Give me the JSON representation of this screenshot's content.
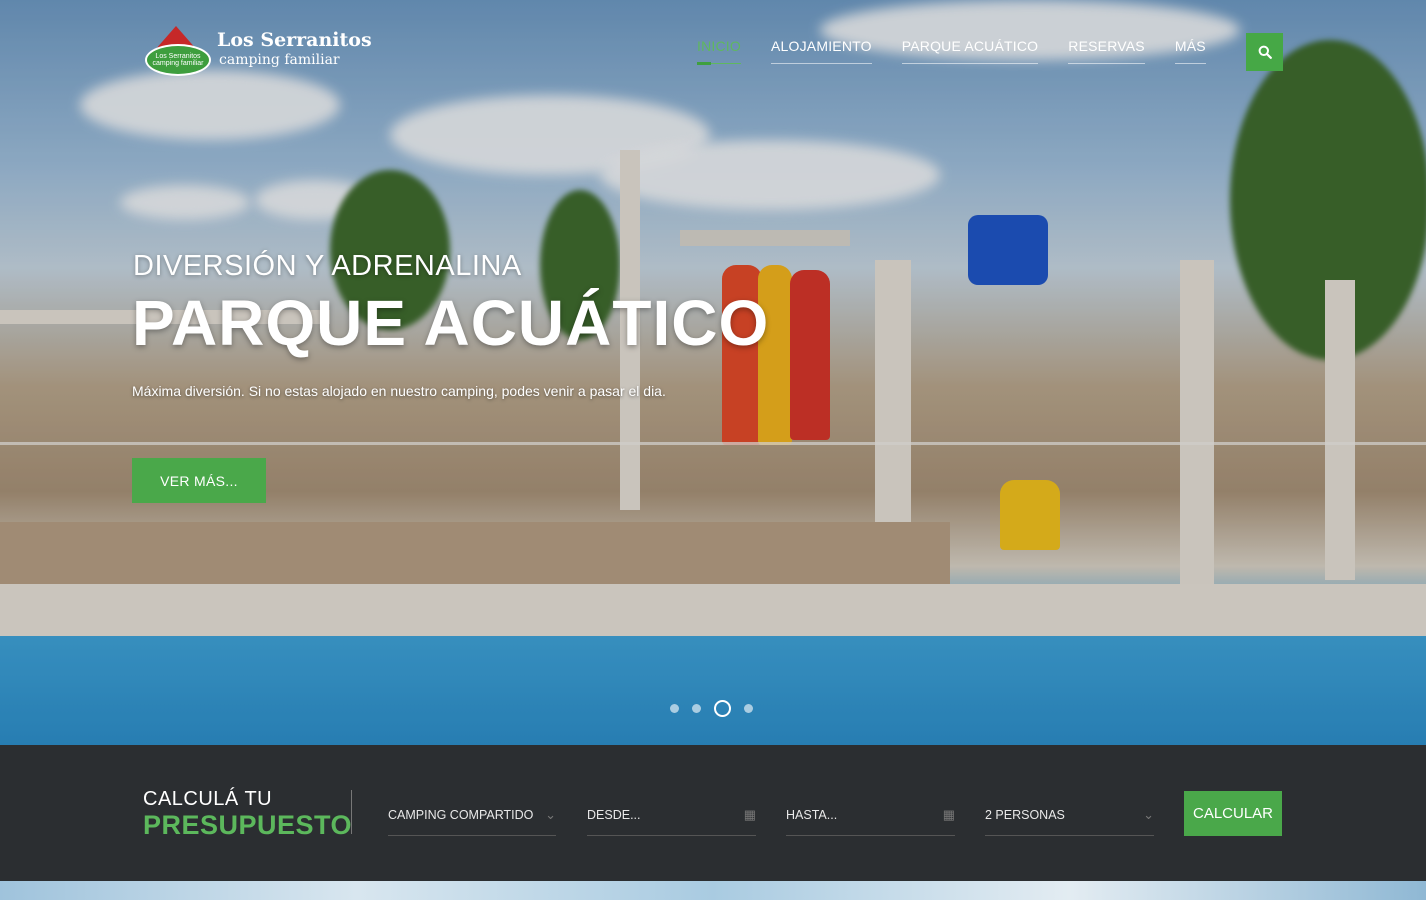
{
  "brand": {
    "line1": "Los Serranitos",
    "line2": "camping familiar",
    "badge": "Los Serranitos camping familiar"
  },
  "nav": {
    "items": [
      {
        "label": "INICIO",
        "active": true
      },
      {
        "label": "ALOJAMIENTO",
        "active": false
      },
      {
        "label": "PARQUE ACUÁTICO",
        "active": false
      },
      {
        "label": "RESERVAS",
        "active": false
      },
      {
        "label": "MÁS",
        "active": false
      }
    ],
    "search_icon": "search-icon"
  },
  "hero": {
    "kicker": "DIVERSIÓN Y ADRENALINA",
    "headline": "PARQUE ACUÁTICO",
    "subtitle": "Máxima diversión. Si no estas alojado en nuestro camping, podes venir a pasar el dia.",
    "cta_label": "VER MÁS...",
    "slides_total": 4,
    "active_slide": 3
  },
  "booking": {
    "title_line1": "CALCULÁ TU",
    "title_line2": "PRESUPUESTO",
    "type_value": "CAMPING COMPARTIDO",
    "from_placeholder": "DESDE...",
    "to_placeholder": "HASTA...",
    "people_value": "2 PERSONAS",
    "submit_label": "CALCULAR"
  },
  "colors": {
    "accent": "#4aa84a",
    "dark_bar": "#2b2e31"
  }
}
